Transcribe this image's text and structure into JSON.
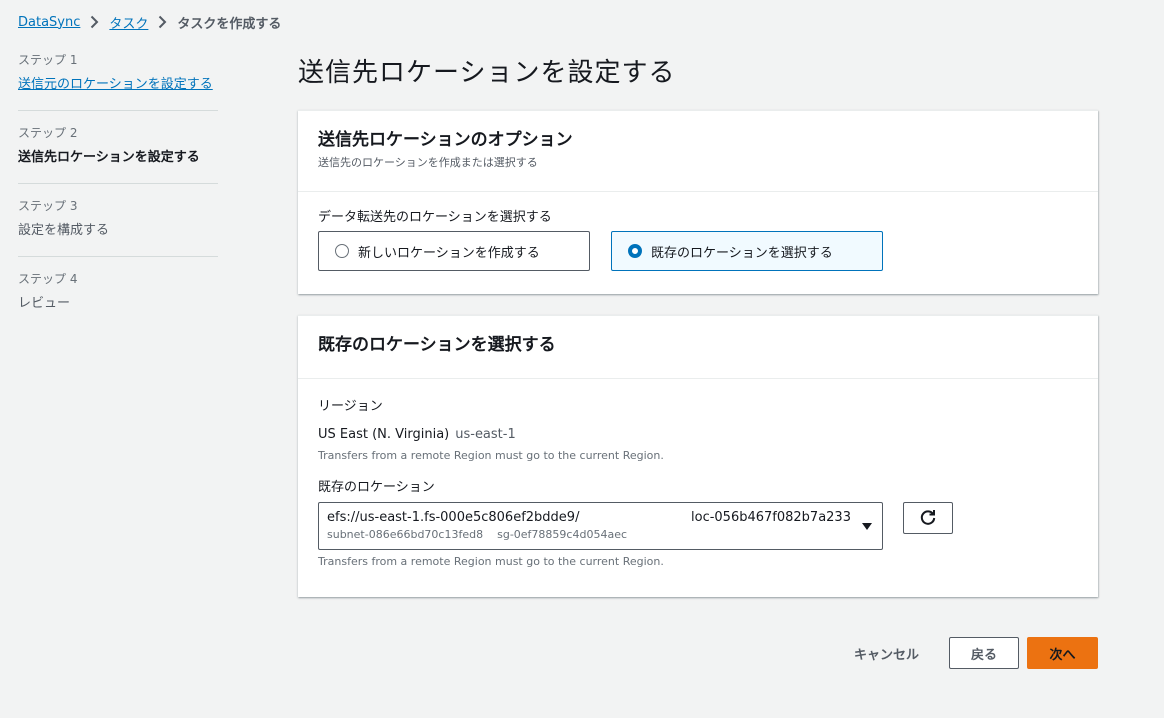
{
  "breadcrumb": {
    "items": [
      "DataSync",
      "タスク"
    ],
    "current": "タスクを作成する"
  },
  "steps": [
    {
      "num": "ステップ 1",
      "title": "送信元のロケーションを設定する"
    },
    {
      "num": "ステップ 2",
      "title": "送信先ロケーションを設定する"
    },
    {
      "num": "ステップ 3",
      "title": "設定を構成する"
    },
    {
      "num": "ステップ 4",
      "title": "レビュー"
    }
  ],
  "page_title": "送信先ロケーションを設定する",
  "options_panel": {
    "title": "送信先ロケーションのオプション",
    "description": "送信先のロケーションを作成または選択する",
    "field_label": "データ転送先のロケーションを選択する",
    "choices": [
      "新しいロケーションを作成する",
      "既存のロケーションを選択する"
    ],
    "selected_index": 1
  },
  "existing_panel": {
    "title": "既存のロケーションを選択する",
    "region_label": "リージョン",
    "region_name": "US East (N. Virginia)",
    "region_code": "us-east-1",
    "region_hint": "Transfers from a remote Region must go to the current Region.",
    "location_label": "既存のロケーション",
    "location_uri": "efs://us-east-1.fs-000e5c806ef2bdde9/",
    "location_id": "loc-056b467f082b7a233",
    "location_subnet": "subnet-086e66bd70c13fed8",
    "location_sg": "sg-0ef78859c4d054aec",
    "location_hint": "Transfers from a remote Region must go to the current Region."
  },
  "footer": {
    "cancel": "キャンセル",
    "back": "戻る",
    "next": "次へ"
  },
  "colors": {
    "accent": "#0073bb",
    "primary_button": "#ec7211",
    "background": "#f2f3f3"
  }
}
